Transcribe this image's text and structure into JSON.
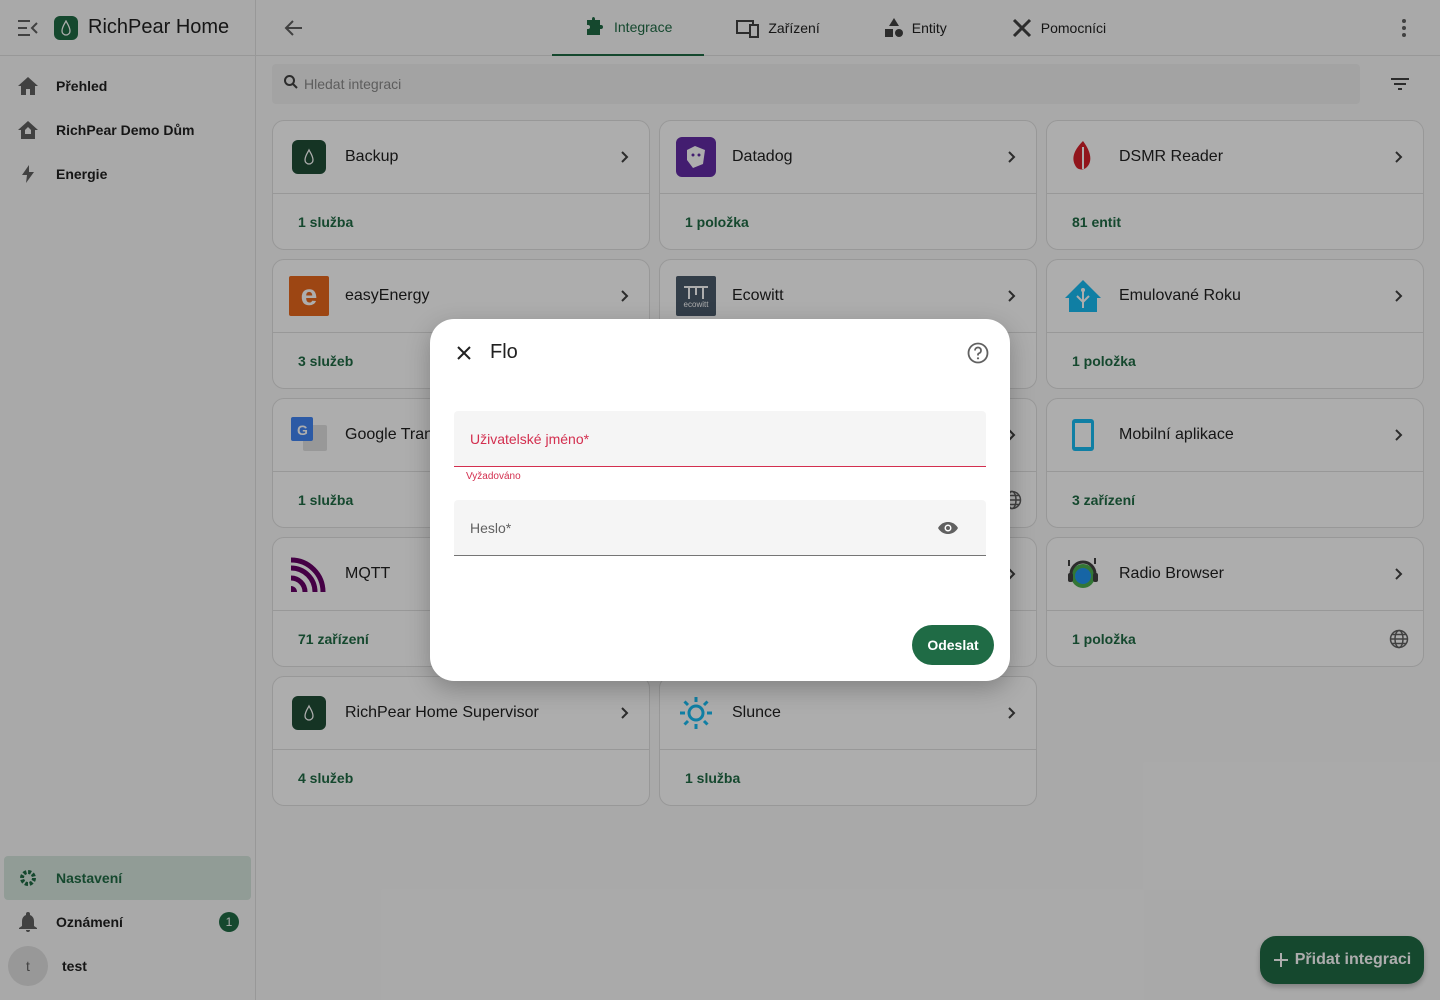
{
  "app": {
    "title": "RichPear Home"
  },
  "sidebar": {
    "items": [
      {
        "label": "Přehled",
        "icon": "home-icon"
      },
      {
        "label": "RichPear Demo Dům",
        "icon": "house-icon"
      },
      {
        "label": "Energie",
        "icon": "lightning-icon"
      }
    ],
    "settings_label": "Nastavení",
    "notifications_label": "Oznámení",
    "notifications_count": "1",
    "user_initial": "t",
    "user_name": "test"
  },
  "tabs": [
    {
      "label": "Integrace",
      "icon": "puzzle-icon",
      "active": true
    },
    {
      "label": "Zařízení",
      "icon": "devices-icon"
    },
    {
      "label": "Entity",
      "icon": "shapes-icon"
    },
    {
      "label": "Pomocníci",
      "icon": "tools-icon"
    }
  ],
  "search": {
    "placeholder": "Hledat integraci"
  },
  "cards": [
    {
      "name": "Backup",
      "subtitle": "1 služba"
    },
    {
      "name": "Datadog",
      "subtitle": "1 položka"
    },
    {
      "name": "DSMR Reader",
      "subtitle": "81 entit"
    },
    {
      "name": "easyEnergy",
      "subtitle": "3 služeb"
    },
    {
      "name": "Ecowitt",
      "subtitle": ""
    },
    {
      "name": "Emulované Roku",
      "subtitle": "1 položka"
    },
    {
      "name": "Google Tran",
      "subtitle": "1 služba"
    },
    {
      "name": "",
      "subtitle": ""
    },
    {
      "name": "Mobilní aplikace",
      "subtitle": "3 zařízení"
    },
    {
      "name": "MQTT",
      "subtitle": "71 zařízení"
    },
    {
      "name": "",
      "subtitle": ""
    },
    {
      "name": "Radio Browser",
      "subtitle": "1 položka"
    },
    {
      "name": "RichPear Home Supervisor",
      "subtitle": "4 služeb"
    },
    {
      "name": "Slunce",
      "subtitle": "1 služba"
    }
  ],
  "ecowitt_logo_text": "ecowitt",
  "easyenergy_logo_text": "e",
  "dialog": {
    "title": "Flo",
    "username_label": "Uživatelské jméno*",
    "username_helper": "Vyžadováno",
    "password_label": "Heslo*",
    "submit_label": "Odeslat"
  },
  "fab": {
    "label": "Přidat integraci"
  },
  "colors": {
    "primary": "#1f6b45",
    "error": "#d32f4f"
  }
}
